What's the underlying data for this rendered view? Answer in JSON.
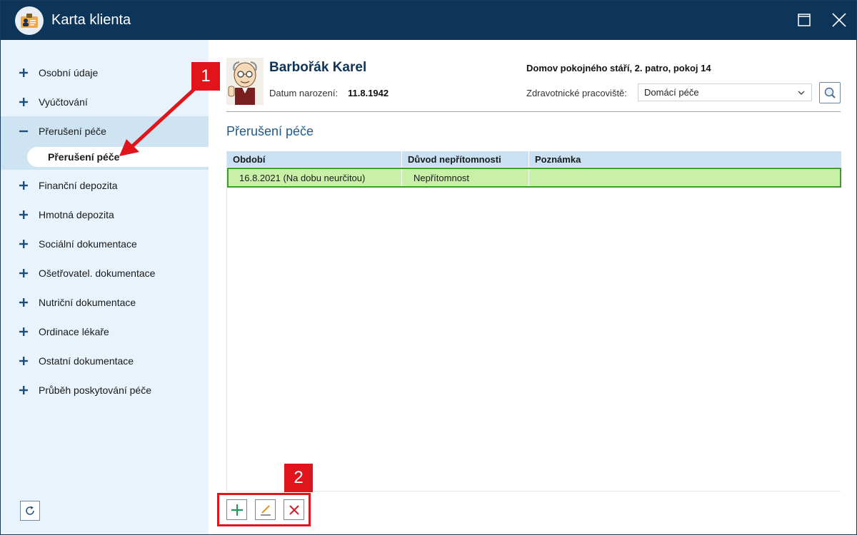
{
  "window": {
    "title": "Karta klienta"
  },
  "sidebar": {
    "items": [
      {
        "label": "Osobní údaje",
        "state": "collapsed"
      },
      {
        "label": "Vyúčtování",
        "state": "collapsed"
      },
      {
        "label": "Přerušení péče",
        "state": "expanded"
      },
      {
        "label": "Finanční depozita",
        "state": "collapsed"
      },
      {
        "label": "Hmotná depozita",
        "state": "collapsed"
      },
      {
        "label": "Sociální dokumentace",
        "state": "collapsed"
      },
      {
        "label": "Ošetřovatel. dokumentace",
        "state": "collapsed"
      },
      {
        "label": "Nutriční dokumentace",
        "state": "collapsed"
      },
      {
        "label": "Ordinace lékaře",
        "state": "collapsed"
      },
      {
        "label": "Ostatní dokumentace",
        "state": "collapsed"
      },
      {
        "label": "Průběh poskytování péče",
        "state": "collapsed"
      }
    ],
    "selected_subitem": "Přerušení péče"
  },
  "client": {
    "name": "Barbořák Karel",
    "birth_label": "Datum narození:",
    "birth_date": "11.8.1942",
    "facility": "Domov pokojného stáří, 2. patro, pokoj 14",
    "workplace_label": "Zdravotnické pracoviště:",
    "workplace_value": "Domácí péče"
  },
  "section": {
    "title": "Přerušení péče"
  },
  "table": {
    "columns": [
      "Období",
      "Důvod nepřítomnosti",
      "Poznámka"
    ],
    "rows": [
      {
        "period": "16.8.2021 (Na dobu neurčitou)",
        "reason": "Nepřítomnost",
        "note": ""
      }
    ]
  },
  "annotations": {
    "badge1": "1",
    "badge2": "2"
  },
  "colors": {
    "titlebar": "#0d3559",
    "sidebar": "#e8f3fb",
    "selected_row": "#c8f0a6",
    "callout": "#e0141a"
  },
  "icons": [
    "app-icon",
    "maximize-icon",
    "close-icon",
    "plus-icon",
    "minus-icon",
    "refresh-icon",
    "search-icon",
    "chevron-down-icon",
    "add-icon",
    "edit-icon",
    "delete-icon"
  ]
}
